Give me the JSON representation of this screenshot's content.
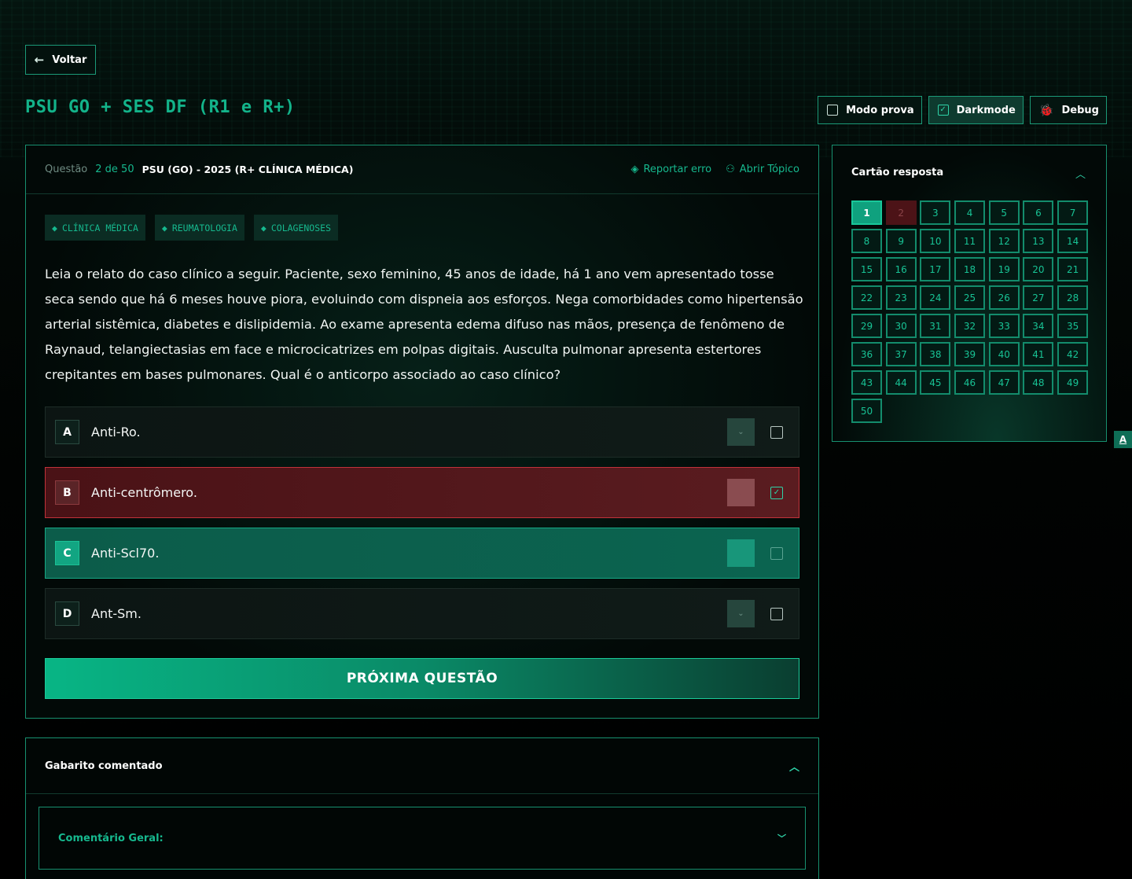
{
  "nav": {
    "back_label": "Voltar"
  },
  "page": {
    "title": "PSU GO + SES DF (R1 e R+)"
  },
  "toggles": [
    {
      "label": "Modo prova",
      "checked": false
    },
    {
      "label": "Darkmode",
      "checked": true
    },
    {
      "label": "Debug"
    }
  ],
  "question": {
    "label": "Questão",
    "number": "2 de 50",
    "source": "PSU (GO) - 2025 (R+ CLÍNICA MÉDICA)",
    "actions": {
      "report": "Reportar erro",
      "topic": "Abrir Tópico"
    },
    "tags": [
      "CLÍNICA MÉDICA",
      "REUMATOLOGIA",
      "COLAGENOSES"
    ],
    "statement": "Leia o relato do caso clínico a seguir. Paciente, sexo feminino, 45 anos de idade, há 1 ano vem apresentado tosse seca sendo que há 6 meses houve piora, evoluindo com dispneia aos esforços. Nega comorbidades como hipertensão arterial sistêmica, diabetes e dislipidemia. Ao exame apresenta edema difuso nas mãos, presença de fenômeno de Raynaud, telangiectasias em face e microcicatrizes em polpas digitais. Ausculta pulmonar apresenta estertores crepitantes em bases pulmonares. Qual é o anticorpo associado ao caso clínico?",
    "options": [
      {
        "letter": "A",
        "text": "Anti-Ro.",
        "state": "neutral",
        "selected": false
      },
      {
        "letter": "B",
        "text": "Anti-centrômero.",
        "state": "wrong",
        "selected": true
      },
      {
        "letter": "C",
        "text": "Anti-Scl70.",
        "state": "correct",
        "selected": false
      },
      {
        "letter": "D",
        "text": "Ant-Sm.",
        "state": "neutral",
        "selected": false
      }
    ],
    "next_label": "PRÓXIMA QUESTÃO"
  },
  "answer_card": {
    "title": "Cartão resposta",
    "current": 1,
    "wrong": [
      2
    ],
    "cells": [
      "1",
      "2",
      "3",
      "4",
      "5",
      "6",
      "7",
      "8",
      "9",
      "10",
      "11",
      "12",
      "13",
      "14",
      "15",
      "16",
      "17",
      "18",
      "19",
      "20",
      "21",
      "22",
      "23",
      "24",
      "25",
      "26",
      "27",
      "28",
      "29",
      "30",
      "31",
      "32",
      "33",
      "34",
      "35",
      "36",
      "37",
      "38",
      "39",
      "40",
      "41",
      "42",
      "43",
      "44",
      "45",
      "46",
      "47",
      "48",
      "49",
      "50"
    ]
  },
  "side_badge": "A",
  "gabarito": {
    "title": "Gabarito comentado",
    "comment_label": "Comentário Geral:"
  },
  "colors": {
    "accent": "#16b88e",
    "wrong": "#5a1c20",
    "correct": "#0b6450"
  }
}
